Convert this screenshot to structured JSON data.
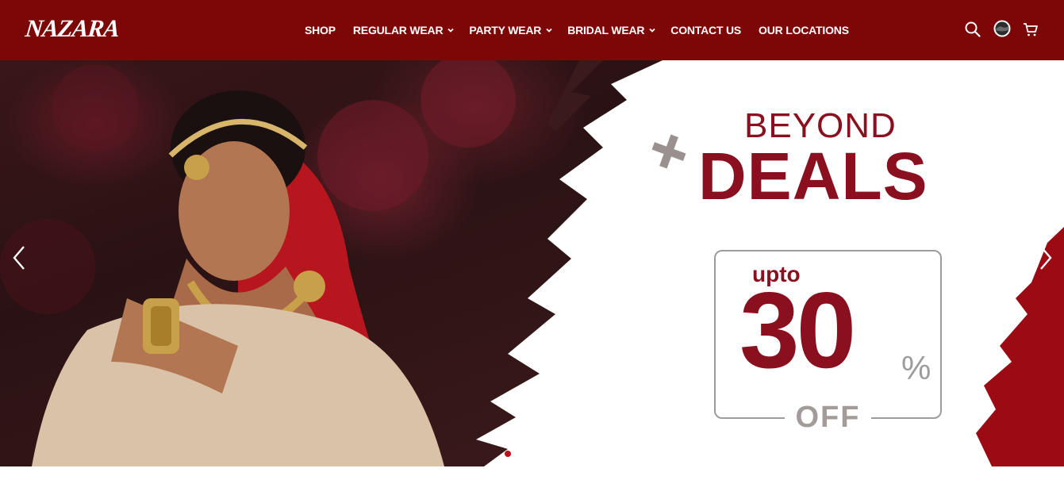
{
  "brand": {
    "logo_text": "NAZARA"
  },
  "nav": {
    "items": [
      {
        "label": "SHOP",
        "has_dropdown": false
      },
      {
        "label": "REGULAR WEAR",
        "has_dropdown": true
      },
      {
        "label": "PARTY WEAR",
        "has_dropdown": true
      },
      {
        "label": "BRIDAL WEAR",
        "has_dropdown": true
      },
      {
        "label": "CONTACT US",
        "has_dropdown": false
      },
      {
        "label": "OUR LOCATIONS",
        "has_dropdown": false
      }
    ]
  },
  "header_icons": [
    "search-icon",
    "account-avatar-icon",
    "cart-icon"
  ],
  "hero": {
    "promo": {
      "line1": "BEYOND",
      "line2": "DEALS",
      "upto": "upto",
      "number": "30",
      "percent": "%",
      "off": "OFF"
    },
    "slides_total": 2,
    "active_slide": 1
  },
  "colors": {
    "header_bg": "#7d0707",
    "brand_red": "#8a1020",
    "grey": "#9c9c9c",
    "dot_active": "#c0101a",
    "dot_inactive": "#ffffff"
  }
}
